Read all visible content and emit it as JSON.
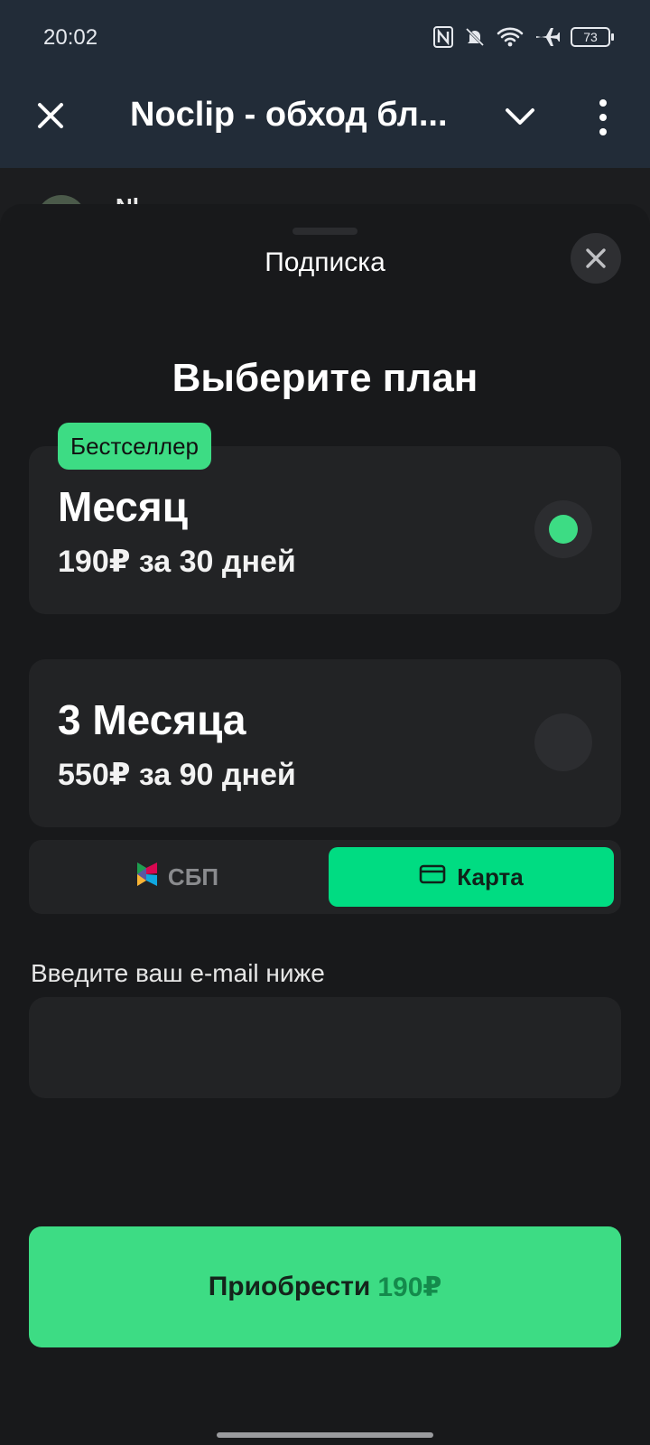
{
  "status_bar": {
    "time": "20:02",
    "battery": "73",
    "icons": [
      "nfc-icon",
      "bell-off-icon",
      "wifi-icon",
      "airplane-icon",
      "battery-icon"
    ]
  },
  "header": {
    "title": "Noclip - обход бл...",
    "icons": [
      "close-icon",
      "chevron-down-icon",
      "more-vert-icon"
    ]
  },
  "peek": {
    "name": "Nl"
  },
  "sheet": {
    "title": "Подписка",
    "heading": "Выберите план",
    "plans": [
      {
        "badge": "Бестселлер",
        "name": "Месяц",
        "price": "190₽ за 30 дней",
        "selected": true
      },
      {
        "name": "3 Месяца",
        "price": "550₽ за 90 дней",
        "selected": false
      }
    ],
    "payment": {
      "sbp_label": "СБП",
      "card_label": "Карта",
      "selected": "card"
    },
    "email": {
      "label": "Введите ваш e-mail ниже",
      "value": "",
      "placeholder": ""
    },
    "buy": {
      "label": "Приобрести",
      "price": "190₽"
    }
  },
  "colors": {
    "accent": "#3ddc84",
    "card_active": "#00dc82",
    "header_bg": "#222c38",
    "sheet_bg": "#18191b",
    "surface": "#222325"
  }
}
